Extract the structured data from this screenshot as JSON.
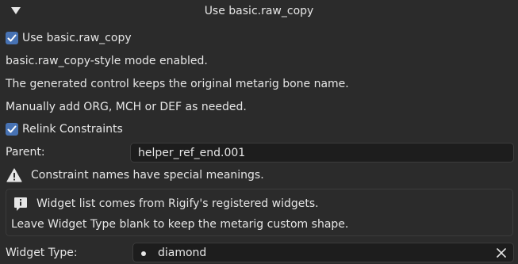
{
  "header": {
    "title": "Use basic.raw_copy",
    "collapse_icon": "triangle-down-icon"
  },
  "use_raw_copy": {
    "label": "Use basic.raw_copy",
    "checked": true
  },
  "info_lines": [
    "basic.raw_copy-style mode enabled.",
    "The generated control keeps the original metarig bone name.",
    "Manually add ORG, MCH or DEF as needed."
  ],
  "relink_constraints": {
    "label": "Relink Constraints",
    "checked": true
  },
  "parent": {
    "label": "Parent:",
    "value": "helper_ref_end.001"
  },
  "warning": {
    "icon": "warning-icon",
    "text": "Constraint names have special meanings."
  },
  "widget_info": {
    "icon": "info-icon",
    "line1": "Widget list comes from Rigify's registered widgets.",
    "line2": "Leave Widget Type blank to keep the metarig custom shape."
  },
  "widget_type": {
    "label": "Widget Type:",
    "value": "diamond",
    "clear_icon": "close-icon"
  },
  "colors": {
    "background": "#2b2b2b",
    "accent": "#4772b3",
    "field": "#1d1d1d",
    "text": "#e6e6e6"
  }
}
